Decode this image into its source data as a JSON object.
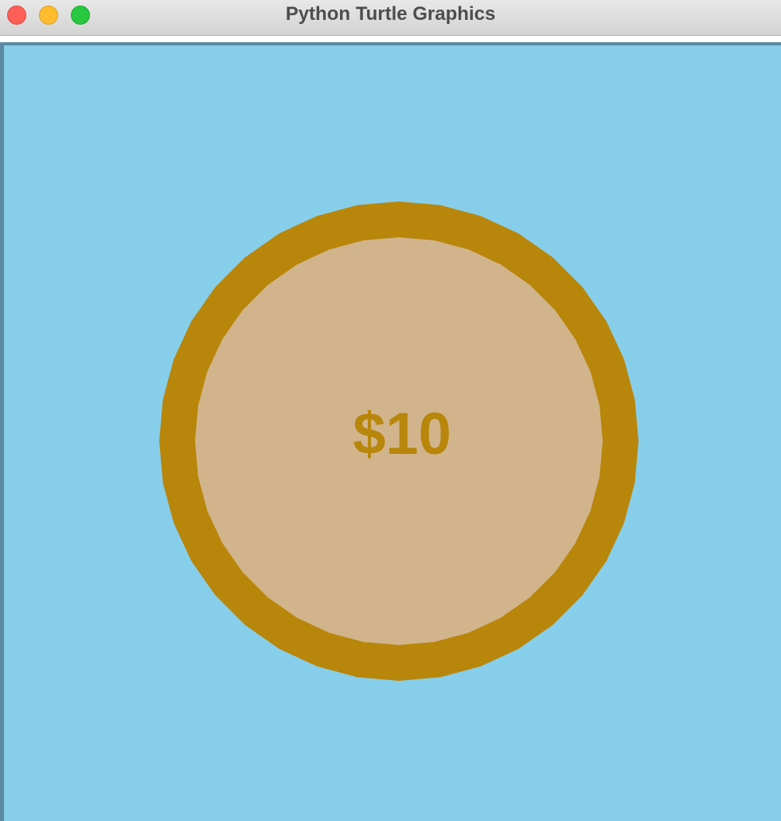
{
  "window": {
    "title": "Python Turtle Graphics",
    "controls": [
      "close",
      "minimize",
      "zoom"
    ]
  },
  "canvas": {
    "background_color": "#87ceea",
    "coin": {
      "label": "$10",
      "rim_color": "#b8860b",
      "face_color": "#d2b48c",
      "label_color": "#b8860b"
    }
  }
}
